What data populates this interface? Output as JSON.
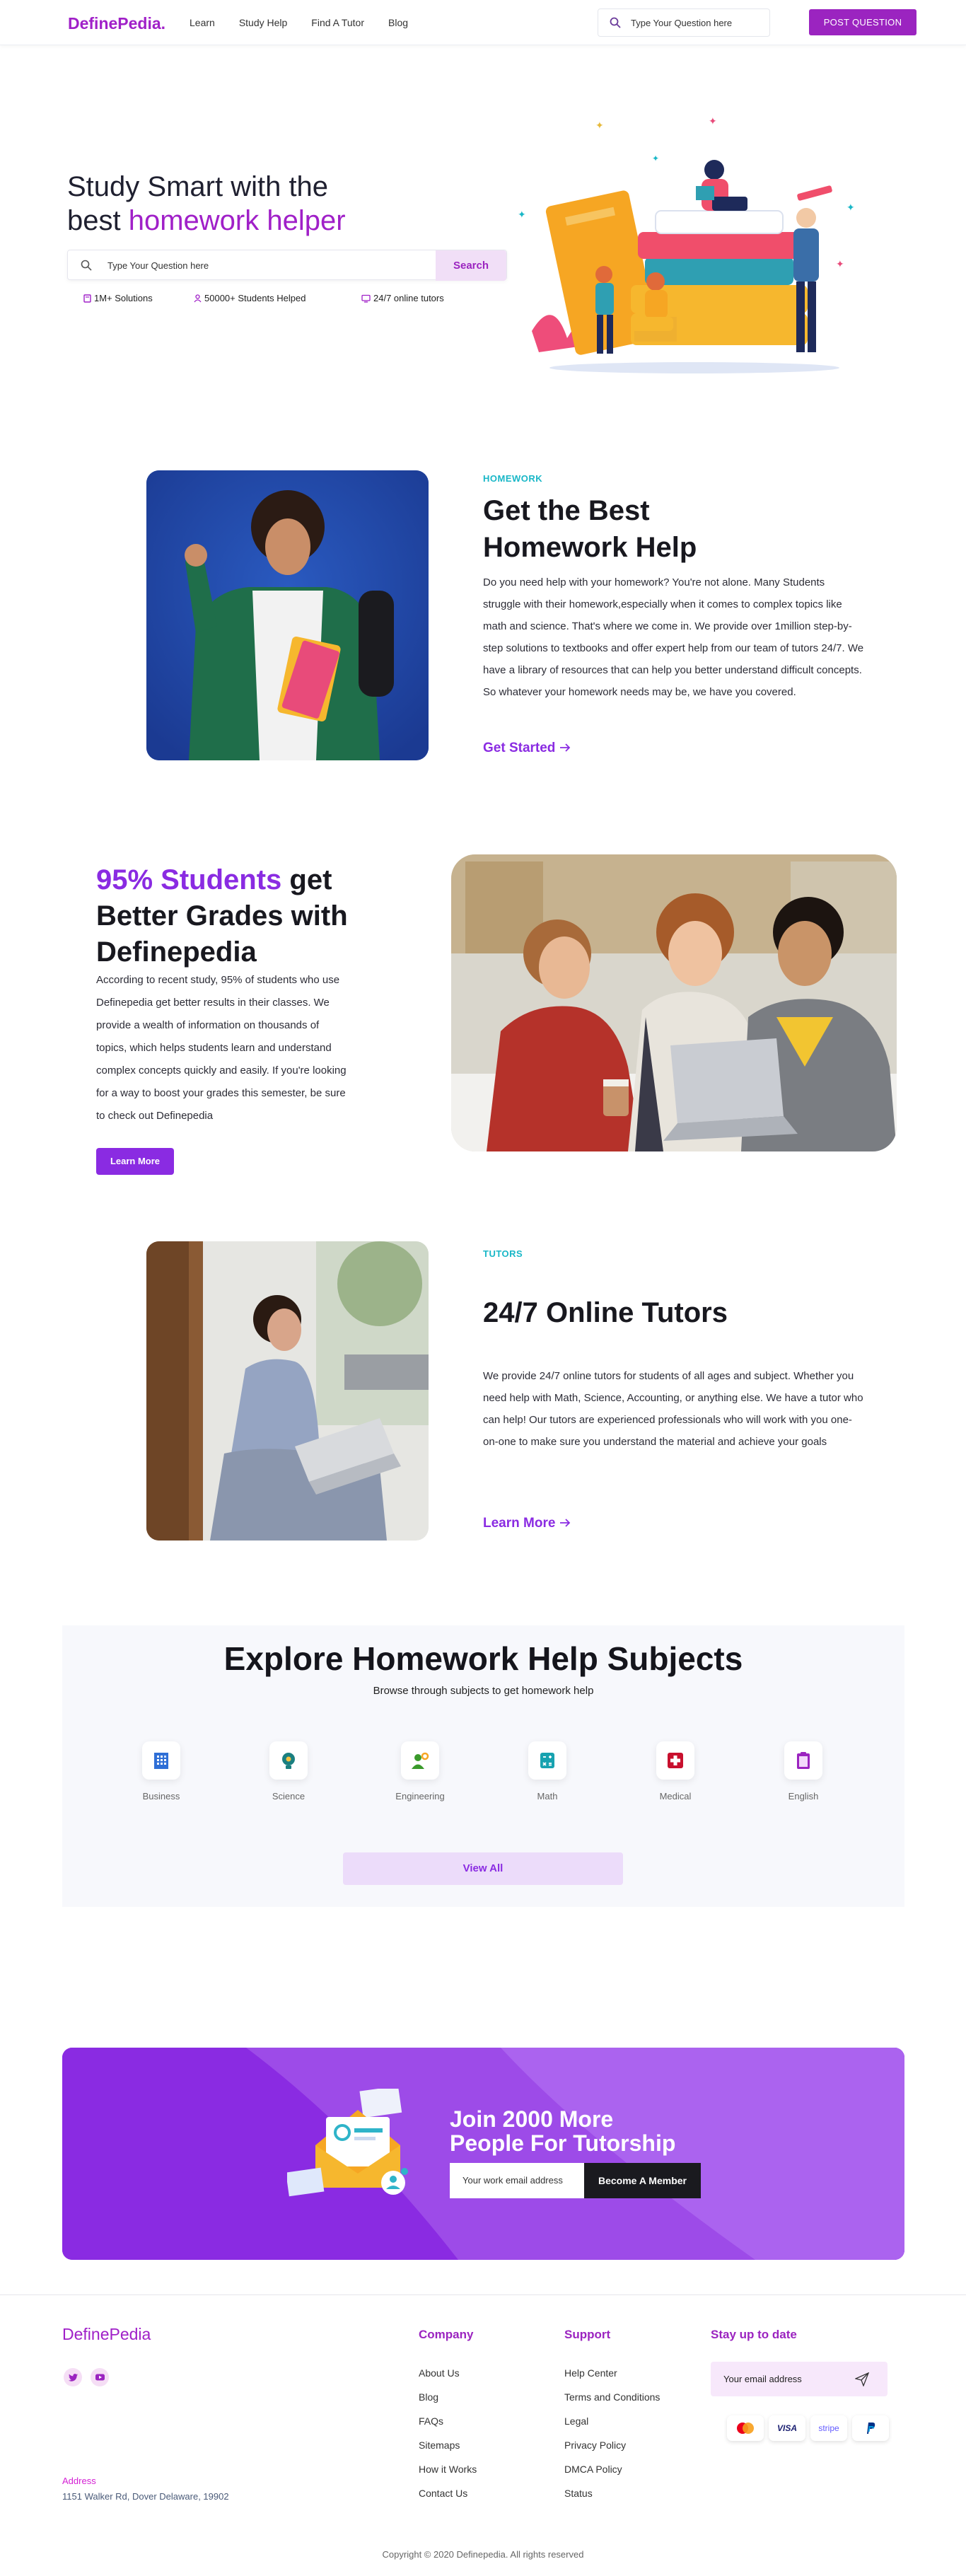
{
  "nav": {
    "logo": "DefinePedia.",
    "links": [
      "Learn",
      "Study Help",
      "Find A Tutor",
      "Blog"
    ],
    "search_placeholder": "Type Your Question here",
    "post_button": "POST QUESTION"
  },
  "hero": {
    "title_line1": "Study Smart with the",
    "title_prefix": "best ",
    "title_accent": "homework helper",
    "search_placeholder": "Type Your Question here",
    "search_button": "Search",
    "stats": [
      "1M+ Solutions",
      "50000+ Students Helped",
      "24/7 online tutors"
    ]
  },
  "homework": {
    "tag": "HOMEWORK",
    "title_line1": "Get the Best",
    "title_line2": "Homework Help",
    "body": "Do you need help with your homework? You're not alone. Many Students struggle with their homework,especially when it comes to complex topics like math and science. That's where we come in. We provide over 1million step-by-step solutions to textbooks and offer expert help from our team of tutors 24/7. We have a library of resources that can help you better understand difficult concepts. So whatever your homework needs may be, we have you covered.",
    "link": "Get Started"
  },
  "grades": {
    "title_accent": "95% Students",
    "title_rest1": " get",
    "title_line2": "Better Grades with",
    "title_line3": "Definepedia",
    "body": "According to recent study, 95% of students who use Definepedia get better results in their classes. We provide a wealth of information on thousands of topics, which helps students learn and understand complex concepts quickly and easily. If you're looking for a way to boost your grades this semester, be sure to check out Definepedia",
    "button": "Learn More"
  },
  "tutors": {
    "tag": "TUTORS",
    "title": "24/7 Online Tutors",
    "body": "We provide 24/7 online tutors for students of all ages and subject. Whether you need help with Math, Science, Accounting, or anything else. We have a tutor who can help! Our tutors are experienced professionals who will work with you one-on-one to make sure you understand the material and achieve your goals",
    "link": "Learn More"
  },
  "subjects": {
    "title": "Explore Homework Help Subjects",
    "subtitle": "Browse through subjects to get homework help",
    "items": [
      {
        "label": "Business",
        "icon": "building-icon",
        "color": "#2f6fd6"
      },
      {
        "label": "Science",
        "icon": "science-bulb-icon",
        "color": "#1a7f80"
      },
      {
        "label": "Engineering",
        "icon": "engineer-icon",
        "color": "#3a9a2b"
      },
      {
        "label": "Math",
        "icon": "calculator-icon",
        "color": "#17a2b0"
      },
      {
        "label": "Medical",
        "icon": "medical-cross-icon",
        "color": "#c8102e"
      },
      {
        "label": "English",
        "icon": "clipboard-icon",
        "color": "#9b24c0"
      }
    ],
    "view_all": "View All"
  },
  "cta": {
    "title_line1": "Join 2000 More",
    "title_line2": "People For Tutorship",
    "email_placeholder": "Your work email address",
    "button": "Become A Member"
  },
  "footer": {
    "logo": "DefinePedia",
    "company_head": "Company",
    "company_links": [
      "About Us",
      "Blog",
      "FAQs",
      "Sitemaps",
      "How it Works",
      "Contact Us"
    ],
    "support_head": "Support",
    "support_links": [
      "Help Center",
      "Terms and Conditions",
      "Legal",
      "Privacy Policy",
      "DMCA Policy",
      "Status"
    ],
    "newsletter_head": "Stay up to date",
    "email_placeholder": "Your email address",
    "payments": [
      "mastercard",
      "VISA",
      "stripe",
      "PayPal"
    ],
    "address_label": "Address",
    "address": "1151 Walker Rd, Dover Delaware, 19902",
    "copyright": "Copyright © 2020 Definepedia. All rights reserved"
  },
  "colors": {
    "brand": "#a020c8",
    "accent_violet": "#8a2be2",
    "teal_tag": "#19b7c7"
  }
}
